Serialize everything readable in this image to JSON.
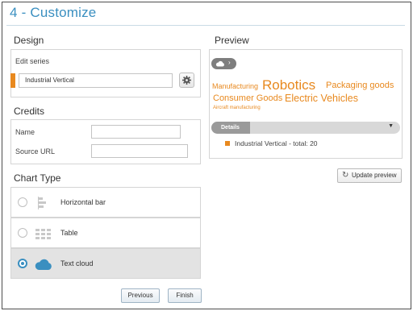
{
  "page": {
    "title": "4 - Customize"
  },
  "design": {
    "heading": "Design",
    "edit_series_label": "Edit series",
    "series_value": "Industrial Vertical",
    "settings_icon": "gear-icon"
  },
  "credits": {
    "heading": "Credits",
    "name_label": "Name",
    "name_value": "",
    "source_label": "Source URL",
    "source_value": ""
  },
  "chart_type": {
    "heading": "Chart Type",
    "options": [
      {
        "label": "Horizontal bar",
        "icon": "horizontal-bar-icon",
        "selected": false
      },
      {
        "label": "Table",
        "icon": "table-icon",
        "selected": false
      },
      {
        "label": "Text cloud",
        "icon": "cloud-icon",
        "selected": true
      }
    ]
  },
  "preview": {
    "heading": "Preview",
    "cloud_words": [
      "Manufacturing",
      "Robotics",
      "Packaging goods",
      "Consumer Goods",
      "Electric Vehicles",
      "Aircraft manufacturing"
    ],
    "details_label": "Details",
    "legend_text": "Industrial Vertical - total: 20",
    "series_color": "#e8891f",
    "update_button": "Update preview"
  },
  "footer": {
    "previous_label": "Previous",
    "finish_label": "Finish"
  },
  "colors": {
    "accent": "#3a8fc0",
    "series": "#e8891f"
  }
}
